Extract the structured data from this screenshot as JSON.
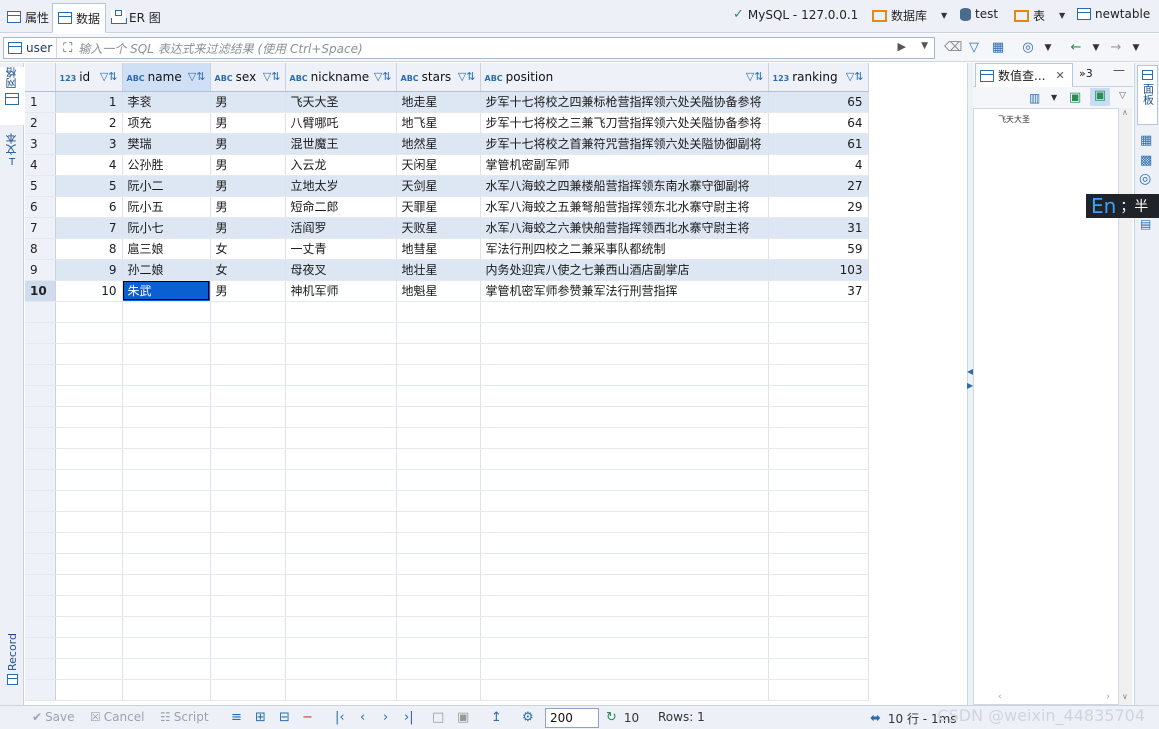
{
  "tabs": [
    {
      "label": "属性"
    },
    {
      "label": "数据"
    },
    {
      "label": "ER 图"
    }
  ],
  "connection": {
    "server": "MySQL - 127.0.0.1",
    "catalog_label": "数据库",
    "schema": "test",
    "table_label": "表",
    "table": "newtable"
  },
  "filter": {
    "table_name": "user",
    "placeholder": "输入一个 SQL 表达式来过滤结果 (使用 Ctrl+Space)"
  },
  "left_tabs": {
    "grid": "网格",
    "text": "文本",
    "record": "Record"
  },
  "columns": [
    {
      "type": "123",
      "name": "id"
    },
    {
      "type": "ABC",
      "name": "name"
    },
    {
      "type": "ABC",
      "name": "sex"
    },
    {
      "type": "ABC",
      "name": "nickname"
    },
    {
      "type": "ABC",
      "name": "stars"
    },
    {
      "type": "ABC",
      "name": "position"
    },
    {
      "type": "123",
      "name": "ranking"
    }
  ],
  "rows": [
    {
      "rownum": "1",
      "id": "1",
      "name": "李衮",
      "sex": "男",
      "nickname": "飞天大圣",
      "stars": "地走星",
      "position": "步军十七将校之四兼标枪营指挥领六处关隘协备参将",
      "ranking": "65"
    },
    {
      "rownum": "2",
      "id": "2",
      "name": "项充",
      "sex": "男",
      "nickname": "八臂哪吒",
      "stars": "地飞星",
      "position": "步军十七将校之三兼飞刀营指挥领六处关隘协备参将",
      "ranking": "64"
    },
    {
      "rownum": "3",
      "id": "3",
      "name": "樊瑞",
      "sex": "男",
      "nickname": "混世魔王",
      "stars": "地然星",
      "position": "步军十七将校之首兼符咒营指挥领六处关隘协御副将",
      "ranking": "61"
    },
    {
      "rownum": "4",
      "id": "4",
      "name": "公孙胜",
      "sex": "男",
      "nickname": "入云龙",
      "stars": "天闲星",
      "position": "掌管机密副军师",
      "ranking": "4"
    },
    {
      "rownum": "5",
      "id": "5",
      "name": "阮小二",
      "sex": "男",
      "nickname": "立地太岁",
      "stars": "天剑星",
      "position": "水军八海蛟之四兼楼船营指挥领东南水寨守御副将",
      "ranking": "27"
    },
    {
      "rownum": "6",
      "id": "6",
      "name": "阮小五",
      "sex": "男",
      "nickname": "短命二郎",
      "stars": "天罪星",
      "position": "水军八海蛟之五兼弩船营指挥领东北水寨守尉主将",
      "ranking": "29"
    },
    {
      "rownum": "7",
      "id": "7",
      "name": "阮小七",
      "sex": "男",
      "nickname": "活阎罗",
      "stars": "天败星",
      "position": "水军八海蛟之六兼快船营指挥领西北水寨守尉主将",
      "ranking": "31"
    },
    {
      "rownum": "8",
      "id": "8",
      "name": "扈三娘",
      "sex": "女",
      "nickname": "一丈青",
      "stars": "地彗星",
      "position": "军法行刑四校之二兼采事队都统制",
      "ranking": "59"
    },
    {
      "rownum": "9",
      "id": "9",
      "name": "孙二娘",
      "sex": "女",
      "nickname": "母夜叉",
      "stars": "地壮星",
      "position": "内务处迎宾八使之七兼西山酒店副掌店",
      "ranking": "103"
    },
    {
      "rownum": "10",
      "id": "10",
      "name": "朱武",
      "sex": "男",
      "nickname": "神机军师",
      "stars": "地魁星",
      "position": "掌管机密军师参赞兼军法行刑营指挥",
      "ranking": "37"
    }
  ],
  "value_panel": {
    "tab_label": "数值查...",
    "overflow_label": "»3",
    "value": "飞天大圣"
  },
  "right_strip": {
    "panels_label": "面板"
  },
  "ime": {
    "mode": "En",
    "rest": "；半"
  },
  "bottom": {
    "save": "Save",
    "cancel": "Cancel",
    "script": "Script",
    "fetch_size": "200",
    "refresh_count": "10",
    "rows_status": "Rows: 1",
    "timing": "10 行 - 1ms",
    "watermark": "CSDN @weixin_44835704"
  }
}
